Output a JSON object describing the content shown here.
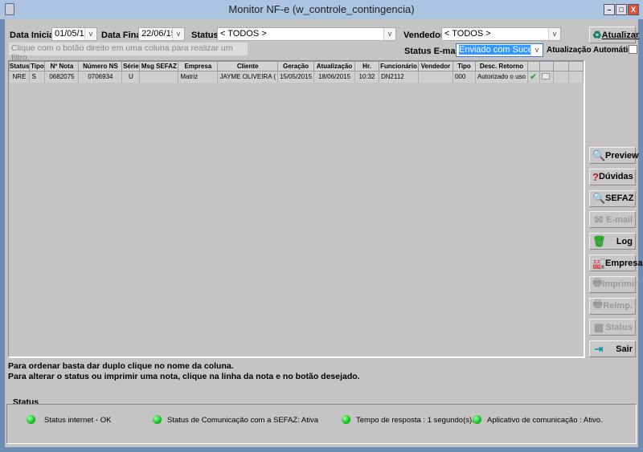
{
  "window": {
    "title": "Monitor NF-e (w_controle_contingencia)",
    "minimize": "–",
    "maximize": "□",
    "close": "X"
  },
  "filters": {
    "data_inicial_label": "Data Inicial:",
    "data_inicial": "01/05/15",
    "data_final_label": "Data Final:",
    "data_final": "22/06/15",
    "status_label": "Status:",
    "status": "< TODOS >",
    "vendedor_label": "Vendedor:",
    "vendedor": "< TODOS >",
    "status_email_label": "Status E-mail:",
    "status_email": "Enviado com Sucess",
    "auto_update_label": "Atualização Automática",
    "auto_update_checked": false,
    "hint": "Clique com o botão direito em uma coluna para realizar um filtro.",
    "atualizar": "Atualizar"
  },
  "grid": {
    "columns": [
      "Status",
      "Tipo",
      "Nº Nota",
      "Número NS",
      "Série",
      "Msg SEFAZ",
      "Empresa",
      "Cliente",
      "Geração",
      "Atualização",
      "Hr.",
      "Funcionário",
      "Vendedor",
      "Tipo",
      "Desc. Retorno",
      "",
      "",
      "",
      ""
    ],
    "rows": [
      [
        "NRE",
        "S",
        "0682075",
        "0706934",
        "U",
        "",
        "Matriz",
        "JAYME OLIVEIRA (",
        "15/05/2015",
        "18/06/2015",
        "10:32",
        "DN2112",
        "",
        "000",
        "Autorizado o uso",
        "",
        "",
        "",
        ""
      ]
    ]
  },
  "buttons": [
    {
      "label": "Preview",
      "icon": "preview-icon",
      "enabled": true,
      "glyph": "🔍"
    },
    {
      "label": "Dúvidas",
      "icon": "question-icon",
      "enabled": true,
      "glyph": "?"
    },
    {
      "label": "SEFAZ",
      "icon": "document-search-icon",
      "enabled": true,
      "glyph": "🔍"
    },
    {
      "label": "E-mail",
      "icon": "email-icon",
      "enabled": false,
      "glyph": "✉"
    },
    {
      "label": "Log",
      "icon": "trash-icon",
      "enabled": true,
      "glyph": "🗑"
    },
    {
      "label": "Empresa",
      "icon": "factory-icon",
      "enabled": true,
      "glyph": "🏭"
    },
    {
      "label": "Imprimir",
      "icon": "printer-icon",
      "enabled": false,
      "glyph": "🖶"
    },
    {
      "label": "Reimp.",
      "icon": "printer-icon",
      "enabled": false,
      "glyph": "🖶"
    },
    {
      "label": "Status",
      "icon": "status-table-icon",
      "enabled": false,
      "glyph": "▦"
    },
    {
      "label": "Sair",
      "icon": "exit-door-icon",
      "enabled": true,
      "glyph": "⇥"
    }
  ],
  "help": {
    "line1": "Para ordenar basta dar duplo clique no nome da coluna.",
    "line2": "Para alterar o status ou imprimir uma nota, clique na linha da nota e no botão desejado."
  },
  "status_panel": {
    "title": "Status",
    "items": [
      "Status internet - OK",
      "Status de Comunicação com a SEFAZ: Ativa",
      "Tempo de resposta : 1 segundo(s).",
      "Aplicativo de comunicação : Ativo."
    ],
    "led_color": "#10c020"
  },
  "colors": {
    "selection": "#3399ff",
    "window_bg": "#c4c4c4",
    "title_bar": "#aac4e2"
  }
}
